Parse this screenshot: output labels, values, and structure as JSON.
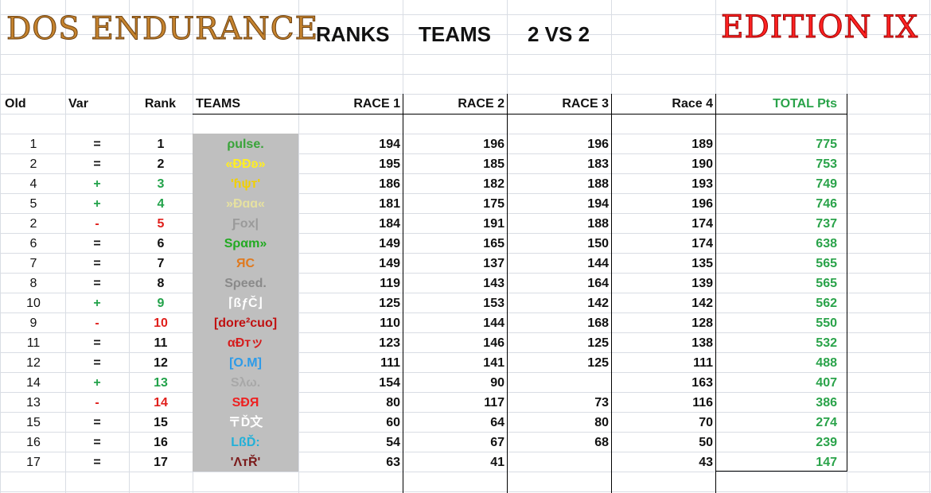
{
  "header": {
    "title_left": "DOS ENDURANCE",
    "title_right": "EDITION IX",
    "nav": [
      "RANKS",
      "TEAMS",
      "2 VS 2"
    ]
  },
  "columns": {
    "old": "Old",
    "var": "Var",
    "rank": "Rank",
    "teams": "TEAMS",
    "race1": "RACE 1",
    "race2": "RACE 2",
    "race3": "RACE 3",
    "race4": "Race 4",
    "total": "TOTAL Pts"
  },
  "colors": {
    "up": "#22a24a",
    "down": "#e0201c",
    "same": "#111111",
    "total": "#2aa34a",
    "teams_bg": "#bfbfbf"
  },
  "rows": [
    {
      "old": "1",
      "var": "=",
      "rank": "1",
      "team": "ρulse.",
      "team_color": "#3aa43a",
      "race1": "194",
      "race2": "196",
      "race3": "196",
      "race4": "189",
      "total": "775"
    },
    {
      "old": "2",
      "var": "=",
      "rank": "2",
      "team": "«ÐÐʚ»",
      "team_color": "#ffee22",
      "race1": "195",
      "race2": "185",
      "race3": "183",
      "race4": "190",
      "total": "753"
    },
    {
      "old": "4",
      "var": "+",
      "rank": "3",
      "team": "'ɦψт'",
      "team_color": "#f2d000",
      "race1": "186",
      "race2": "182",
      "race3": "188",
      "race4": "193",
      "total": "749"
    },
    {
      "old": "5",
      "var": "+",
      "rank": "4",
      "team": "»Ðɑɑ«",
      "team_color": "#e6e1a0",
      "race1": "181",
      "race2": "175",
      "race3": "194",
      "race4": "196",
      "total": "746"
    },
    {
      "old": "2",
      "var": "-",
      "rank": "5",
      "team": "Ƒox|",
      "team_color": "#9a9a9a",
      "race1": "184",
      "race2": "191",
      "race3": "188",
      "race4": "174",
      "total": "737"
    },
    {
      "old": "6",
      "var": "=",
      "rank": "6",
      "team": "Sραm»",
      "team_color": "#22aa22",
      "race1": "149",
      "race2": "165",
      "race3": "150",
      "race4": "174",
      "total": "638"
    },
    {
      "old": "7",
      "var": "=",
      "rank": "7",
      "team": "ЯC",
      "team_color": "#e07a1f",
      "race1": "149",
      "race2": "137",
      "race3": "144",
      "race4": "135",
      "total": "565"
    },
    {
      "old": "8",
      "var": "=",
      "rank": "8",
      "team": "Sρeed.",
      "team_color": "#8a8a8a",
      "race1": "119",
      "race2": "143",
      "race3": "164",
      "race4": "139",
      "total": "565"
    },
    {
      "old": "10",
      "var": "+",
      "rank": "9",
      "team": "⌈ßƒČ⌋",
      "team_color": "#ffffff",
      "race1": "125",
      "race2": "153",
      "race3": "142",
      "race4": "142",
      "total": "562"
    },
    {
      "old": "9",
      "var": "-",
      "rank": "10",
      "team": "[dore²cuo]",
      "team_color": "#c01010",
      "race1": "110",
      "race2": "144",
      "race3": "168",
      "race4": "128",
      "total": "550"
    },
    {
      "old": "11",
      "var": "=",
      "rank": "11",
      "team": "αÐтッ",
      "team_color": "#d51d1d",
      "race1": "123",
      "race2": "146",
      "race3": "125",
      "race4": "138",
      "total": "532"
    },
    {
      "old": "12",
      "var": "=",
      "rank": "12",
      "team": "[O.M]",
      "team_color": "#2d9be8",
      "race1": "111",
      "race2": "141",
      "race3": "125",
      "race4": "111",
      "total": "488"
    },
    {
      "old": "14",
      "var": "+",
      "rank": "13",
      "team": "Sλω.",
      "team_color": "#a8a8a8",
      "race1": "154",
      "race2": "90",
      "race3": "",
      "race4": "163",
      "total": "407"
    },
    {
      "old": "13",
      "var": "-",
      "rank": "14",
      "team": "SÐЯ",
      "team_color": "#ee2020",
      "race1": "80",
      "race2": "117",
      "race3": "73",
      "race4": "116",
      "total": "386"
    },
    {
      "old": "15",
      "var": "=",
      "rank": "15",
      "team": "〒Ď文",
      "team_color": "#ffffff",
      "race1": "60",
      "race2": "64",
      "race3": "80",
      "race4": "70",
      "total": "274"
    },
    {
      "old": "16",
      "var": "=",
      "rank": "16",
      "team": "LßĎ:",
      "team_color": "#22b0d8",
      "race1": "54",
      "race2": "67",
      "race3": "68",
      "race4": "50",
      "total": "239"
    },
    {
      "old": "17",
      "var": "=",
      "rank": "17",
      "team": "'ΛтŘ'",
      "team_color": "#7a1a1a",
      "race1": "63",
      "race2": "41",
      "race3": "",
      "race4": "43",
      "total": "147"
    }
  ]
}
